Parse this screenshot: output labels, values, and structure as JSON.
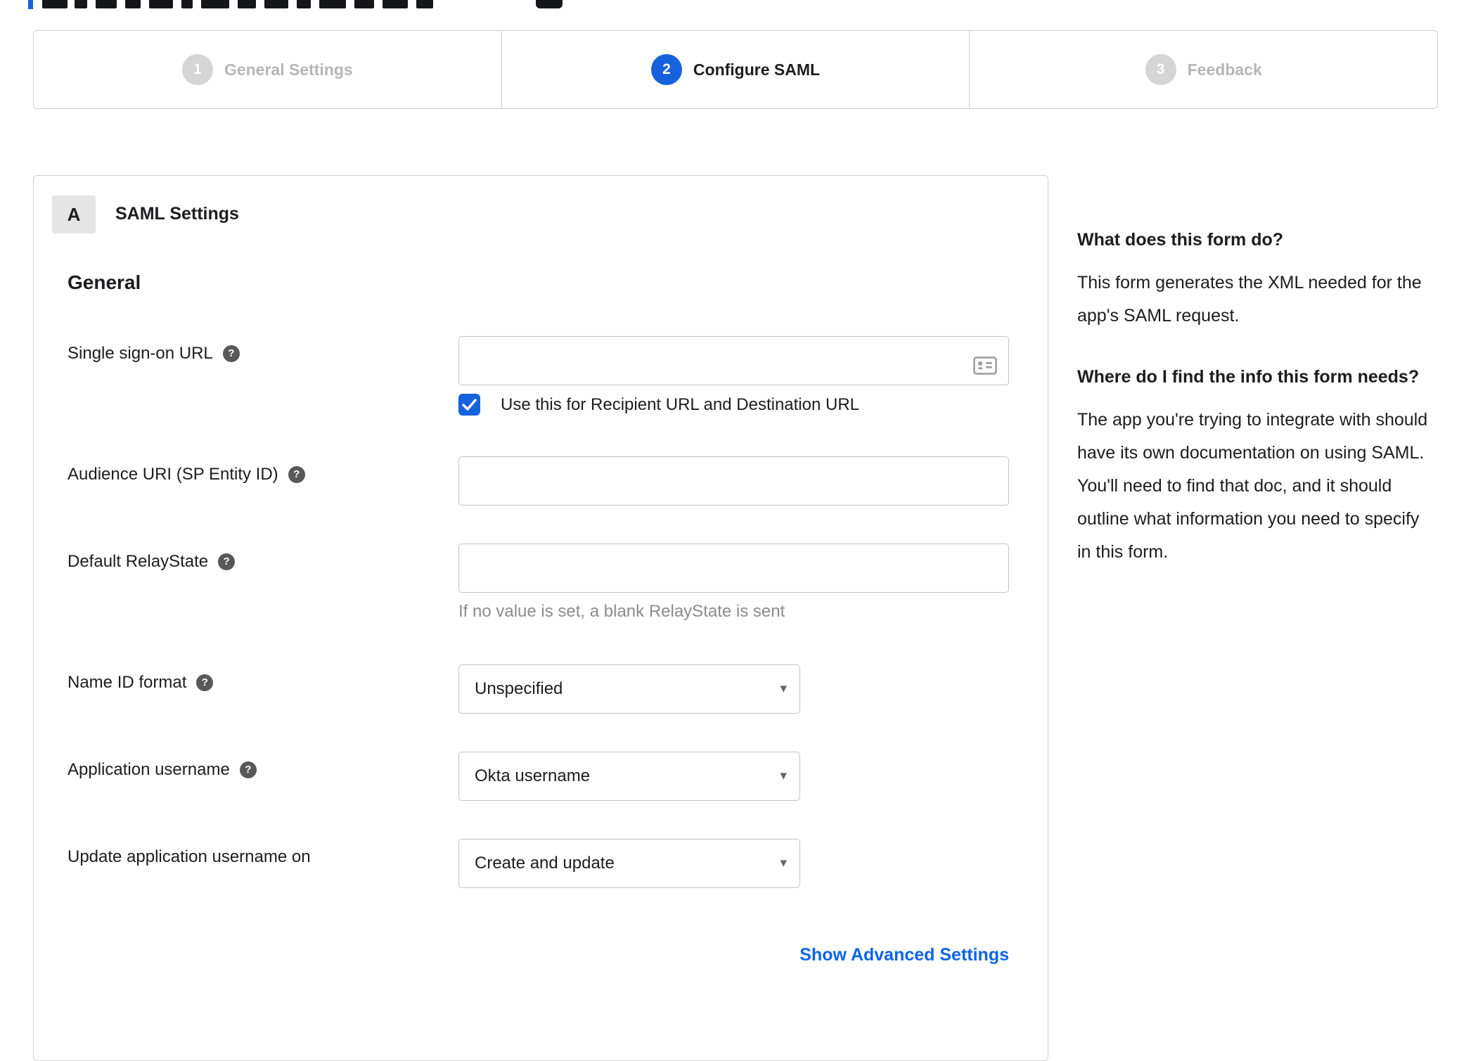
{
  "colors": {
    "accent": "#1662dd",
    "link": "#0d64e8",
    "inactive_circle": "#d5d5d5",
    "inactive_label": "#b6b6b6",
    "border": "#cfcfcf"
  },
  "icons": {
    "help": "?",
    "caret": "▾"
  },
  "stepper": {
    "steps": [
      {
        "number": "1",
        "label": "General Settings",
        "active": false
      },
      {
        "number": "2",
        "label": "Configure SAML",
        "active": true
      },
      {
        "number": "3",
        "label": "Feedback",
        "active": false
      }
    ]
  },
  "panel": {
    "badge": "A",
    "title": "SAML Settings",
    "section_heading": "General",
    "sso": {
      "label": "Single sign-on URL",
      "value": "",
      "checkbox_checked": true,
      "checkbox_label": "Use this for Recipient URL and Destination URL"
    },
    "audience": {
      "label": "Audience URI (SP Entity ID)",
      "value": ""
    },
    "relay": {
      "label": "Default RelayState",
      "value": "",
      "hint": "If no value is set, a blank RelayState is sent"
    },
    "name_id": {
      "label": "Name ID format",
      "value": "Unspecified"
    },
    "app_username": {
      "label": "Application username",
      "value": "Okta username"
    },
    "update_username": {
      "label": "Update application username on",
      "value": "Create and update"
    },
    "advanced_link": "Show Advanced Settings"
  },
  "sidebar": {
    "sections": [
      {
        "heading": "What does this form do?",
        "body": "This form generates the XML needed for the app's SAML request."
      },
      {
        "heading": "Where do I find the info this form needs?",
        "body": "The app you're trying to integrate with should have its own documentation on using SAML. You'll need to find that doc, and it should outline what information you need to specify in this form."
      }
    ]
  }
}
